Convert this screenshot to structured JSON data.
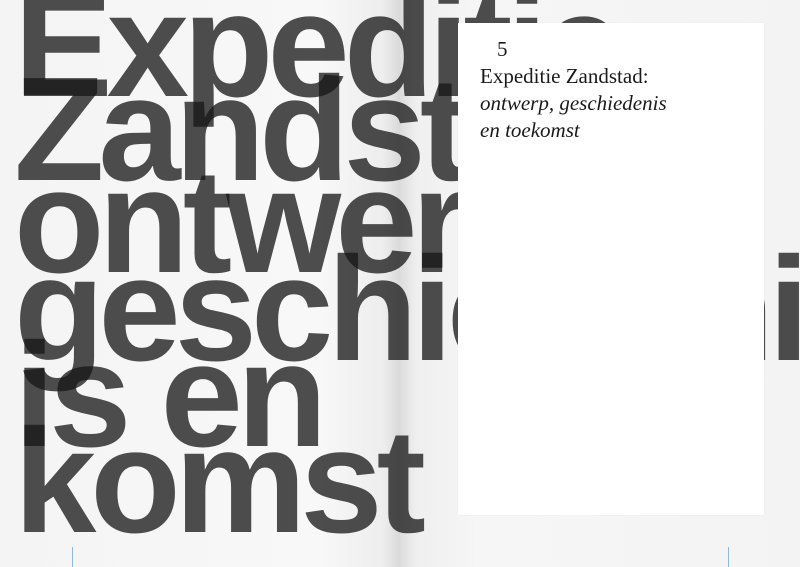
{
  "cover_type": {
    "lines": [
      "Expeditie",
      "Zandstad:",
      "ontwerp,",
      "geschiedenis",
      "is en",
      "komst"
    ]
  },
  "card": {
    "number": "5",
    "title_main": "Expeditie Zandstad:",
    "title_sub_line1": "ontwerp, geschiedenis",
    "title_sub_line2": "en toekomst"
  },
  "colors": {
    "type": "#161616",
    "card_background": "#ffffff",
    "page_background": "#f7f7f7"
  }
}
